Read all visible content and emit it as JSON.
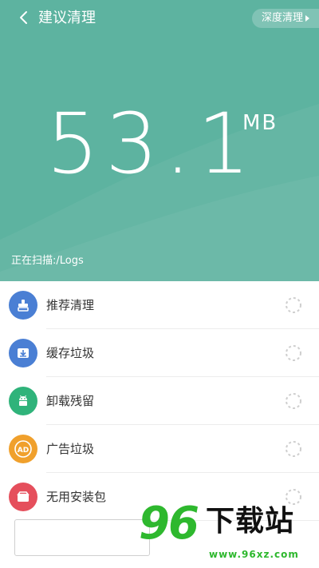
{
  "header": {
    "title": "建议清理",
    "deep_clean_label": "深度清理",
    "size_value": "53.1",
    "size_unit": "MB",
    "scan_status": "正在扫描:/Logs",
    "background_color": "#5db3a0"
  },
  "list": {
    "items": [
      {
        "label": "推荐清理",
        "icon": "broom-icon",
        "color": "#4a7fd4"
      },
      {
        "label": "缓存垃圾",
        "icon": "download-box-icon",
        "color": "#4a7fd4"
      },
      {
        "label": "卸载残留",
        "icon": "android-icon",
        "color": "#2fb37a"
      },
      {
        "label": "广告垃圾",
        "icon": "ad-icon",
        "color": "#f0a02c"
      },
      {
        "label": "无用安装包",
        "icon": "package-icon",
        "color": "#e54f5c"
      }
    ]
  },
  "watermark": {
    "number": "96",
    "text": "下载站",
    "url": "www.96xz.com"
  }
}
